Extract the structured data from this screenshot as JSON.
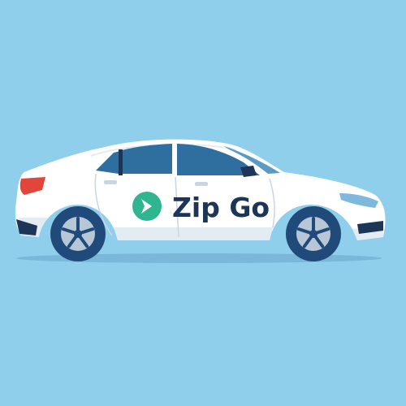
{
  "scene": {
    "background_color": "#90cfeb",
    "ground_shadow_color": "#7ab7d8",
    "car": {
      "body_color": "#ffffff",
      "body_shade_color": "#e4ecf3",
      "window_color": "#2f6f9f",
      "window_highlight_color": "#5a9ac4",
      "trim_color": "#1d3557",
      "tire_color": "#1f4a7a",
      "rim_color": "#b8c7d6",
      "tail_light_color": "#e2453b",
      "head_light_color": "#7fb8dd"
    },
    "logo": {
      "icon": "chevron-right-icon",
      "badge_color": "#2fb58f",
      "text": "Zip Go",
      "text_color": "#1d3557"
    }
  }
}
